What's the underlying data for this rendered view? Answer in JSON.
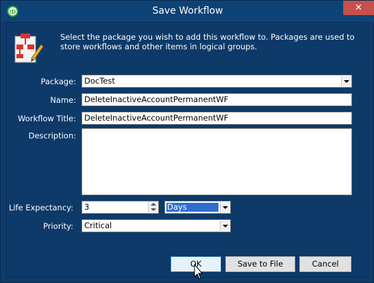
{
  "window": {
    "title": "Save Workflow",
    "close_label": "✕"
  },
  "header": {
    "description": "Select the package you wish to add this workflow to. Packages are used to store workflows and other items in logical groups."
  },
  "form": {
    "package_label": "Package:",
    "package_value": "DocTest",
    "name_label": "Name:",
    "name_value": "DeleteInactiveAccountPermanentWF",
    "workflow_title_label": "Workflow Title:",
    "workflow_title_value": "DeleteInactiveAccountPermanentWF",
    "description_label": "Description:",
    "description_value": "",
    "life_expectancy_label": "Life Expectancy:",
    "life_expectancy_value": "3",
    "life_expectancy_unit": "Days",
    "priority_label": "Priority:",
    "priority_value": "Critical"
  },
  "buttons": {
    "ok": "OK",
    "save_to_file": "Save to File",
    "cancel": "Cancel"
  },
  "colors": {
    "background": "#0e3c6b",
    "close_button": "#c7504c",
    "selection": "#2f6fd0"
  }
}
